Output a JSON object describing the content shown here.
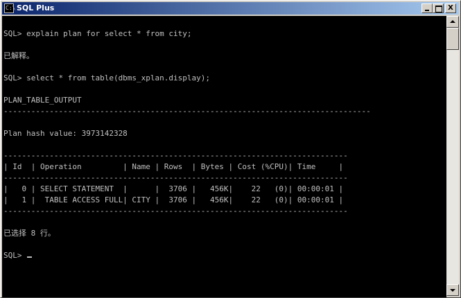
{
  "window": {
    "title": "SQL Plus",
    "buttons": {
      "minimize": "_",
      "maximize": "□",
      "close": "X"
    },
    "icon": "console-app-icon",
    "titlebar_color_start": "#0a246a",
    "titlebar_color_end": "#a6caf0"
  },
  "console": {
    "background": "#000000",
    "text_color": "#c0c0c0",
    "lines": [
      "SQL> explain plan for select * from city;",
      "",
      "已解释。",
      "",
      "SQL> select * from table(dbms_xplan.display);",
      "",
      "PLAN_TABLE_OUTPUT",
      "--------------------------------------------------------------------------------",
      "",
      "Plan hash value: 3973142328",
      "",
      "---------------------------------------------------------------------------",
      "| Id  | Operation         | Name | Rows  | Bytes | Cost (%CPU)| Time     |",
      "---------------------------------------------------------------------------",
      "|   0 | SELECT STATEMENT  |      |  3706 |   456K|    22   (0)| 00:00:01 |",
      "|   1 |  TABLE ACCESS FULL| CITY |  3706 |   456K|    22   (0)| 00:00:01 |",
      "---------------------------------------------------------------------------",
      "",
      "已选择 8 行。",
      "",
      "SQL> "
    ]
  },
  "scrollbar": {
    "up": "scroll-up-arrow",
    "down": "scroll-down-arrow"
  }
}
